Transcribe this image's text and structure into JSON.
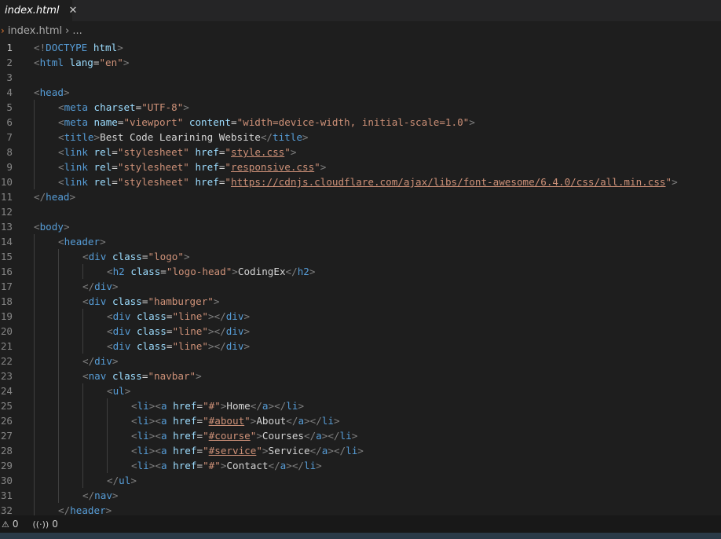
{
  "tab": {
    "label": "index.html",
    "close": "✕"
  },
  "breadcrumb": {
    "arrow": "›",
    "file": "index.html",
    "sep": "›",
    "more": "..."
  },
  "status": {
    "problems_icon": "⚠",
    "problems_count": "0",
    "ports_icon": "((·))",
    "ports_count": "0"
  },
  "active_line": 1,
  "lines": [
    {
      "n": "1",
      "indent": 0,
      "tokens": [
        [
          "punc",
          "<!"
        ],
        [
          "tag",
          "DOCTYPE"
        ],
        [
          "text",
          " "
        ],
        [
          "kw",
          "html"
        ],
        [
          "punc",
          ">"
        ]
      ]
    },
    {
      "n": "2",
      "indent": 0,
      "tokens": [
        [
          "punc",
          "<"
        ],
        [
          "tag",
          "html"
        ],
        [
          "text",
          " "
        ],
        [
          "attr",
          "lang"
        ],
        [
          "text",
          "="
        ],
        [
          "str",
          "\"en\""
        ],
        [
          "punc",
          ">"
        ]
      ]
    },
    {
      "n": "3",
      "indent": 0,
      "tokens": []
    },
    {
      "n": "4",
      "indent": 0,
      "tokens": [
        [
          "punc",
          "<"
        ],
        [
          "tag",
          "head"
        ],
        [
          "punc",
          ">"
        ]
      ]
    },
    {
      "n": "5",
      "indent": 1,
      "tokens": [
        [
          "punc",
          "<"
        ],
        [
          "tag",
          "meta"
        ],
        [
          "text",
          " "
        ],
        [
          "attr",
          "charset"
        ],
        [
          "text",
          "="
        ],
        [
          "str",
          "\"UTF-8\""
        ],
        [
          "punc",
          ">"
        ]
      ]
    },
    {
      "n": "6",
      "indent": 1,
      "tokens": [
        [
          "punc",
          "<"
        ],
        [
          "tag",
          "meta"
        ],
        [
          "text",
          " "
        ],
        [
          "attr",
          "name"
        ],
        [
          "text",
          "="
        ],
        [
          "str",
          "\"viewport\""
        ],
        [
          "text",
          " "
        ],
        [
          "attr",
          "content"
        ],
        [
          "text",
          "="
        ],
        [
          "str",
          "\"width=device-width, initial-scale=1.0\""
        ],
        [
          "punc",
          ">"
        ]
      ]
    },
    {
      "n": "7",
      "indent": 1,
      "tokens": [
        [
          "punc",
          "<"
        ],
        [
          "tag",
          "title"
        ],
        [
          "punc",
          ">"
        ],
        [
          "text",
          "Best Code Learining Website"
        ],
        [
          "punc",
          "</"
        ],
        [
          "tag",
          "title"
        ],
        [
          "punc",
          ">"
        ]
      ]
    },
    {
      "n": "8",
      "indent": 1,
      "tokens": [
        [
          "punc",
          "<"
        ],
        [
          "tag",
          "link"
        ],
        [
          "text",
          " "
        ],
        [
          "attr",
          "rel"
        ],
        [
          "text",
          "="
        ],
        [
          "str",
          "\"stylesheet\""
        ],
        [
          "text",
          " "
        ],
        [
          "attr",
          "href"
        ],
        [
          "text",
          "="
        ],
        [
          "str",
          "\""
        ],
        [
          "strlink",
          "style.css"
        ],
        [
          "str",
          "\""
        ],
        [
          "punc",
          ">"
        ]
      ]
    },
    {
      "n": "9",
      "indent": 1,
      "tokens": [
        [
          "punc",
          "<"
        ],
        [
          "tag",
          "link"
        ],
        [
          "text",
          " "
        ],
        [
          "attr",
          "rel"
        ],
        [
          "text",
          "="
        ],
        [
          "str",
          "\"stylesheet\""
        ],
        [
          "text",
          " "
        ],
        [
          "attr",
          "href"
        ],
        [
          "text",
          "="
        ],
        [
          "str",
          "\""
        ],
        [
          "strlink",
          "responsive.css"
        ],
        [
          "str",
          "\""
        ],
        [
          "punc",
          ">"
        ]
      ]
    },
    {
      "n": "10",
      "indent": 1,
      "tokens": [
        [
          "punc",
          "<"
        ],
        [
          "tag",
          "link"
        ],
        [
          "text",
          " "
        ],
        [
          "attr",
          "rel"
        ],
        [
          "text",
          "="
        ],
        [
          "str",
          "\"stylesheet\""
        ],
        [
          "text",
          " "
        ],
        [
          "attr",
          "href"
        ],
        [
          "text",
          "="
        ],
        [
          "str",
          "\""
        ],
        [
          "strlink",
          "https://cdnjs.cloudflare.com/ajax/libs/font-awesome/6.4.0/css/all.min.css"
        ],
        [
          "str",
          "\""
        ],
        [
          "punc",
          ">"
        ]
      ]
    },
    {
      "n": "11",
      "indent": 0,
      "tokens": [
        [
          "punc",
          "</"
        ],
        [
          "tag",
          "head"
        ],
        [
          "punc",
          ">"
        ]
      ]
    },
    {
      "n": "12",
      "indent": 0,
      "tokens": []
    },
    {
      "n": "13",
      "indent": 0,
      "tokens": [
        [
          "punc",
          "<"
        ],
        [
          "tag",
          "body"
        ],
        [
          "punc",
          ">"
        ]
      ]
    },
    {
      "n": "14",
      "indent": 1,
      "tokens": [
        [
          "punc",
          "<"
        ],
        [
          "tag",
          "header"
        ],
        [
          "punc",
          ">"
        ]
      ]
    },
    {
      "n": "15",
      "indent": 2,
      "tokens": [
        [
          "punc",
          "<"
        ],
        [
          "tag",
          "div"
        ],
        [
          "text",
          " "
        ],
        [
          "attr",
          "class"
        ],
        [
          "text",
          "="
        ],
        [
          "str",
          "\"logo\""
        ],
        [
          "punc",
          ">"
        ]
      ]
    },
    {
      "n": "16",
      "indent": 3,
      "tokens": [
        [
          "punc",
          "<"
        ],
        [
          "tag",
          "h2"
        ],
        [
          "text",
          " "
        ],
        [
          "attr",
          "class"
        ],
        [
          "text",
          "="
        ],
        [
          "str",
          "\"logo-head\""
        ],
        [
          "punc",
          ">"
        ],
        [
          "text",
          "CodingEx"
        ],
        [
          "punc",
          "</"
        ],
        [
          "tag",
          "h2"
        ],
        [
          "punc",
          ">"
        ]
      ]
    },
    {
      "n": "17",
      "indent": 2,
      "tokens": [
        [
          "punc",
          "</"
        ],
        [
          "tag",
          "div"
        ],
        [
          "punc",
          ">"
        ]
      ]
    },
    {
      "n": "18",
      "indent": 2,
      "tokens": [
        [
          "punc",
          "<"
        ],
        [
          "tag",
          "div"
        ],
        [
          "text",
          " "
        ],
        [
          "attr",
          "class"
        ],
        [
          "text",
          "="
        ],
        [
          "str",
          "\"hamburger\""
        ],
        [
          "punc",
          ">"
        ]
      ]
    },
    {
      "n": "19",
      "indent": 3,
      "tokens": [
        [
          "punc",
          "<"
        ],
        [
          "tag",
          "div"
        ],
        [
          "text",
          " "
        ],
        [
          "attr",
          "class"
        ],
        [
          "text",
          "="
        ],
        [
          "str",
          "\"line\""
        ],
        [
          "punc",
          "></"
        ],
        [
          "tag",
          "div"
        ],
        [
          "punc",
          ">"
        ]
      ]
    },
    {
      "n": "20",
      "indent": 3,
      "tokens": [
        [
          "punc",
          "<"
        ],
        [
          "tag",
          "div"
        ],
        [
          "text",
          " "
        ],
        [
          "attr",
          "class"
        ],
        [
          "text",
          "="
        ],
        [
          "str",
          "\"line\""
        ],
        [
          "punc",
          "></"
        ],
        [
          "tag",
          "div"
        ],
        [
          "punc",
          ">"
        ]
      ]
    },
    {
      "n": "21",
      "indent": 3,
      "tokens": [
        [
          "punc",
          "<"
        ],
        [
          "tag",
          "div"
        ],
        [
          "text",
          " "
        ],
        [
          "attr",
          "class"
        ],
        [
          "text",
          "="
        ],
        [
          "str",
          "\"line\""
        ],
        [
          "punc",
          "></"
        ],
        [
          "tag",
          "div"
        ],
        [
          "punc",
          ">"
        ]
      ]
    },
    {
      "n": "22",
      "indent": 2,
      "tokens": [
        [
          "punc",
          "</"
        ],
        [
          "tag",
          "div"
        ],
        [
          "punc",
          ">"
        ]
      ]
    },
    {
      "n": "23",
      "indent": 2,
      "tokens": [
        [
          "punc",
          "<"
        ],
        [
          "tag",
          "nav"
        ],
        [
          "text",
          " "
        ],
        [
          "attr",
          "class"
        ],
        [
          "text",
          "="
        ],
        [
          "str",
          "\"navbar\""
        ],
        [
          "punc",
          ">"
        ]
      ]
    },
    {
      "n": "24",
      "indent": 3,
      "tokens": [
        [
          "punc",
          "<"
        ],
        [
          "tag",
          "ul"
        ],
        [
          "punc",
          ">"
        ]
      ]
    },
    {
      "n": "25",
      "indent": 4,
      "tokens": [
        [
          "punc",
          "<"
        ],
        [
          "tag",
          "li"
        ],
        [
          "punc",
          "><"
        ],
        [
          "tag",
          "a"
        ],
        [
          "text",
          " "
        ],
        [
          "attr",
          "href"
        ],
        [
          "text",
          "="
        ],
        [
          "str",
          "\"#\""
        ],
        [
          "punc",
          ">"
        ],
        [
          "text",
          "Home"
        ],
        [
          "punc",
          "</"
        ],
        [
          "tag",
          "a"
        ],
        [
          "punc",
          "></"
        ],
        [
          "tag",
          "li"
        ],
        [
          "punc",
          ">"
        ]
      ]
    },
    {
      "n": "26",
      "indent": 4,
      "tokens": [
        [
          "punc",
          "<"
        ],
        [
          "tag",
          "li"
        ],
        [
          "punc",
          "><"
        ],
        [
          "tag",
          "a"
        ],
        [
          "text",
          " "
        ],
        [
          "attr",
          "href"
        ],
        [
          "text",
          "="
        ],
        [
          "str",
          "\""
        ],
        [
          "strlink",
          "#about"
        ],
        [
          "str",
          "\""
        ],
        [
          "punc",
          ">"
        ],
        [
          "text",
          "About"
        ],
        [
          "punc",
          "</"
        ],
        [
          "tag",
          "a"
        ],
        [
          "punc",
          "></"
        ],
        [
          "tag",
          "li"
        ],
        [
          "punc",
          ">"
        ]
      ]
    },
    {
      "n": "27",
      "indent": 4,
      "tokens": [
        [
          "punc",
          "<"
        ],
        [
          "tag",
          "li"
        ],
        [
          "punc",
          "><"
        ],
        [
          "tag",
          "a"
        ],
        [
          "text",
          " "
        ],
        [
          "attr",
          "href"
        ],
        [
          "text",
          "="
        ],
        [
          "str",
          "\""
        ],
        [
          "strlink",
          "#course"
        ],
        [
          "str",
          "\""
        ],
        [
          "punc",
          ">"
        ],
        [
          "text",
          "Courses"
        ],
        [
          "punc",
          "</"
        ],
        [
          "tag",
          "a"
        ],
        [
          "punc",
          "></"
        ],
        [
          "tag",
          "li"
        ],
        [
          "punc",
          ">"
        ]
      ]
    },
    {
      "n": "28",
      "indent": 4,
      "tokens": [
        [
          "punc",
          "<"
        ],
        [
          "tag",
          "li"
        ],
        [
          "punc",
          "><"
        ],
        [
          "tag",
          "a"
        ],
        [
          "text",
          " "
        ],
        [
          "attr",
          "href"
        ],
        [
          "text",
          "="
        ],
        [
          "str",
          "\""
        ],
        [
          "strlink",
          "#service"
        ],
        [
          "str",
          "\""
        ],
        [
          "punc",
          ">"
        ],
        [
          "text",
          "Service"
        ],
        [
          "punc",
          "</"
        ],
        [
          "tag",
          "a"
        ],
        [
          "punc",
          "></"
        ],
        [
          "tag",
          "li"
        ],
        [
          "punc",
          ">"
        ]
      ]
    },
    {
      "n": "29",
      "indent": 4,
      "tokens": [
        [
          "punc",
          "<"
        ],
        [
          "tag",
          "li"
        ],
        [
          "punc",
          "><"
        ],
        [
          "tag",
          "a"
        ],
        [
          "text",
          " "
        ],
        [
          "attr",
          "href"
        ],
        [
          "text",
          "="
        ],
        [
          "str",
          "\"#\""
        ],
        [
          "punc",
          ">"
        ],
        [
          "text",
          "Contact"
        ],
        [
          "punc",
          "</"
        ],
        [
          "tag",
          "a"
        ],
        [
          "punc",
          "></"
        ],
        [
          "tag",
          "li"
        ],
        [
          "punc",
          ">"
        ]
      ]
    },
    {
      "n": "30",
      "indent": 3,
      "tokens": [
        [
          "punc",
          "</"
        ],
        [
          "tag",
          "ul"
        ],
        [
          "punc",
          ">"
        ]
      ]
    },
    {
      "n": "31",
      "indent": 2,
      "tokens": [
        [
          "punc",
          "</"
        ],
        [
          "tag",
          "nav"
        ],
        [
          "punc",
          ">"
        ]
      ]
    },
    {
      "n": "32",
      "indent": 1,
      "tokens": [
        [
          "punc",
          "</"
        ],
        [
          "tag",
          "header"
        ],
        [
          "punc",
          ">"
        ]
      ]
    }
  ]
}
